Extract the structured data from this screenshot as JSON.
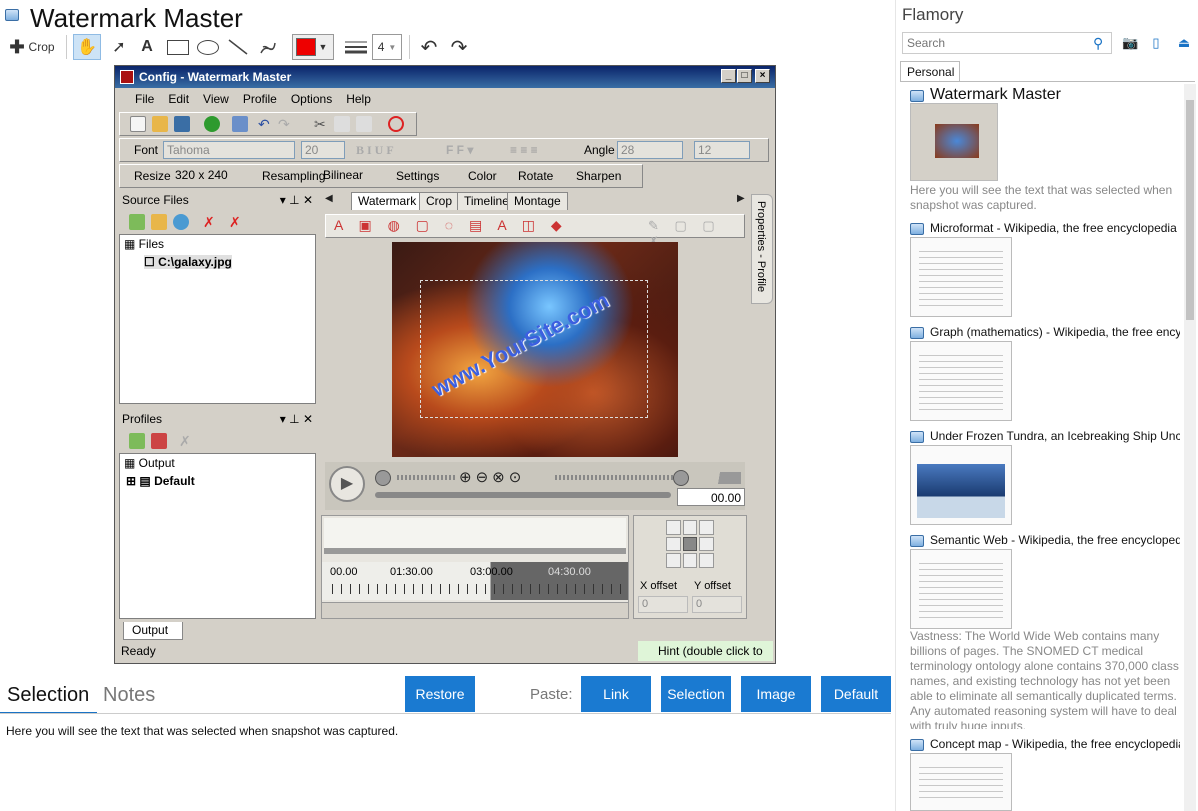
{
  "app": {
    "title": "Watermark Master"
  },
  "toolbar": {
    "crop_label": "Crop",
    "line_width_value": "4",
    "tool_icons": [
      "hand-icon",
      "arrow-icon",
      "text-icon",
      "rectangle-icon",
      "ellipse-icon",
      "line-icon",
      "freehand-icon"
    ],
    "color_value": "#ee0000",
    "undo_icon": "undo-icon",
    "redo_icon": "redo-icon"
  },
  "screenshot": {
    "window_title": "Config - Watermark Master",
    "menu": [
      "File",
      "Edit",
      "View",
      "Profile",
      "Options",
      "Help"
    ],
    "font_label": "Font",
    "font_value": "Tahoma",
    "font_size_value": "20",
    "angle_label": "Angle",
    "angle_value": "28",
    "angle_extra_value": "12",
    "resize_label": "Resize",
    "resize_value": "320 x 240",
    "resampling_label": "Resampling",
    "resampling_value": "Bilinear",
    "settings_label": "Settings",
    "color_label": "Color",
    "rotate_label": "Rotate",
    "sharpen_label": "Sharpen",
    "source_files_label": "Source Files",
    "files_label": "Files",
    "file_item": "C:\\galaxy.jpg",
    "profiles_label": "Profiles",
    "output_label": "Output",
    "default_label": "Default",
    "tabs": [
      "Watermark",
      "Crop",
      "Timeline",
      "Montage"
    ],
    "side_tab": "Properties - Profile",
    "watermark_text": "www.YourSite.com",
    "time_display": "00.00",
    "timeline_marks": [
      "00.00",
      "01:30.00",
      "03:00.00",
      "04:30.00"
    ],
    "x_offset_label": "X offset",
    "y_offset_label": "Y offset",
    "x_offset_value": "0",
    "y_offset_value": "0",
    "output_tab": "Output",
    "status": "Ready",
    "hint": "Hint (double click to"
  },
  "bottom": {
    "tab_selection": "Selection",
    "tab_notes": "Notes",
    "restore_label": "Restore",
    "paste_label": "Paste:",
    "paste_link": "Link",
    "paste_selection": "Selection",
    "paste_image": "Image",
    "paste_default": "Default",
    "selection_text": "Here you will see the text that was selected when snapshot was captured."
  },
  "sidebar": {
    "title": "Flamory",
    "search_placeholder": "Search",
    "tab": "Personal",
    "snapshots": [
      {
        "title": "Watermark Master",
        "desc": "Here you will see the text that was selected when snapshot was captured."
      },
      {
        "title": "Microformat - Wikipedia, the free encyclopedia"
      },
      {
        "title": "Graph (mathematics) - Wikipedia, the free ency"
      },
      {
        "title": "Under Frozen Tundra, an Icebreaking Ship Unco"
      },
      {
        "title": "Semantic Web - Wikipedia, the free encycloped",
        "desc": "Vastness: The World Wide Web contains many billions of pages. The SNOMED CT medical terminology ontology alone contains 370,000 class names, and existing technology has not yet been able to eliminate all semantically duplicated terms. Any automated reasoning system will have to deal with truly huge inputs."
      },
      {
        "title": "Concept map - Wikipedia, the free encyclopedia"
      }
    ]
  },
  "colors": {
    "accent": "#1a7ad1",
    "titlebar": "#0a246a",
    "hint_bg": "#dff5d8"
  }
}
